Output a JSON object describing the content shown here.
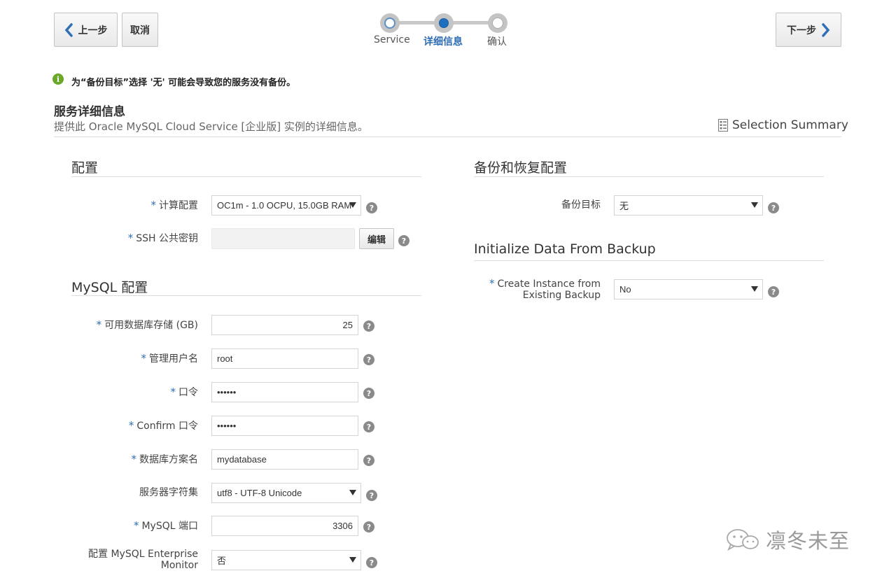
{
  "nav": {
    "back_label": "上一步",
    "cancel_label": "取消",
    "next_label": "下一步"
  },
  "train": {
    "steps": [
      {
        "label": "Service",
        "state": "visited"
      },
      {
        "label": "详细信息",
        "state": "current"
      },
      {
        "label": "确认",
        "state": "unvisited"
      }
    ]
  },
  "info_message": "为“备份目标”选择 '无' 可能会导致您的服务没有备份。",
  "page": {
    "title": "服务详细信息",
    "description": "提供此 Oracle MySQL Cloud Service [企业版] 实例的详细信息。",
    "summary_link": "Selection Summary"
  },
  "config": {
    "title": "配置",
    "compute_label": "计算配置",
    "compute_value": "OC1m - 1.0 OCPU, 15.0GB RAM",
    "ssh_label": "SSH 公共密钥",
    "ssh_value": "",
    "edit_label": "编辑"
  },
  "mysql": {
    "title": "MySQL 配置",
    "storage_label": "可用数据库存储 (GB)",
    "storage_value": "25",
    "admin_label": "管理用户名",
    "admin_value": "root",
    "password_label": "口令",
    "password_value": "••••••",
    "confirm_label": "Confirm 口令",
    "confirm_value": "••••••",
    "schema_label": "数据库方案名",
    "schema_value": "mydatabase",
    "charset_label": "服务器字符集",
    "charset_value": "utf8 - UTF-8 Unicode",
    "port_label": "MySQL 端口",
    "port_value": "3306",
    "monitor_label_1": "配置 MySQL Enterprise",
    "monitor_label_2": "Monitor",
    "monitor_value": "否"
  },
  "backup": {
    "title": "备份和恢复配置",
    "dest_label": "备份目标",
    "dest_value": "无"
  },
  "init": {
    "title": "Initialize Data From Backup",
    "create_label_1": "Create Instance from",
    "create_label_2": "Existing Backup",
    "create_value": "No"
  },
  "help_glyph": "?",
  "required_marker": "*",
  "info_glyph": "i",
  "watermark": "凛冬未至",
  "colors": {
    "accent_blue": "#2f6fb8",
    "info_green": "#6aa829",
    "help_gray": "#8a8a8a"
  }
}
